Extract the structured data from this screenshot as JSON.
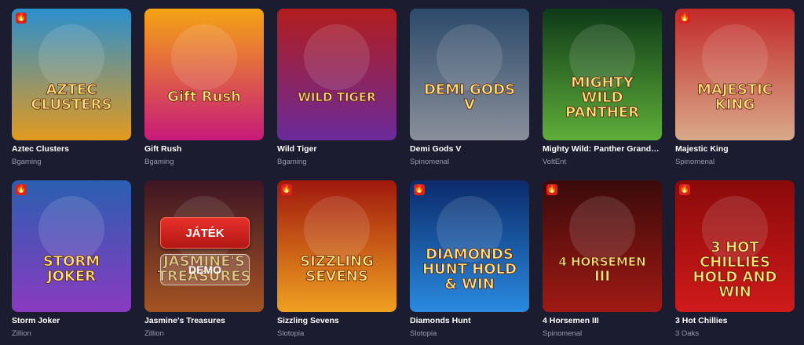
{
  "games": [
    {
      "title": "Aztec Clusters",
      "provider": "Bgaming",
      "hot": true,
      "art_text": "AZTEC CLUSTERS",
      "colors": [
        "#2a8fcf",
        "#e39a1e"
      ]
    },
    {
      "title": "Gift Rush",
      "provider": "Bgaming",
      "hot": false,
      "art_text": "Gift Rush",
      "colors": [
        "#f5a414",
        "#c81a7a"
      ]
    },
    {
      "title": "Wild Tiger",
      "provider": "Bgaming",
      "hot": false,
      "art_text": "WILD TIGER",
      "colors": [
        "#b21d1d",
        "#6a2a9a"
      ]
    },
    {
      "title": "Demi Gods V",
      "provider": "Spinomenal",
      "hot": false,
      "art_text": "DEMI GODS V",
      "colors": [
        "#2c4a6a",
        "#8a8f9a"
      ]
    },
    {
      "title": "Mighty Wild: Panther Grand Diamond Edition",
      "provider": "VoltEnt",
      "hot": false,
      "art_text": "MIGHTY WILD PANTHER",
      "colors": [
        "#0d3a18",
        "#5fae3a"
      ]
    },
    {
      "title": "Majestic King",
      "provider": "Spinomenal",
      "hot": true,
      "art_text": "MAJESTIC KING",
      "colors": [
        "#c22a2a",
        "#d9a98a"
      ]
    },
    {
      "title": "Storm Joker",
      "provider": "Zillion",
      "hot": true,
      "art_text": "STORM JOKER",
      "colors": [
        "#2a5fb0",
        "#8a3ac0"
      ]
    },
    {
      "title": "Jasmine's Treasures",
      "provider": "Zillion",
      "hot": false,
      "art_text": "JASMINE'S TREASURES",
      "colors": [
        "#4a1a2a",
        "#c2632a"
      ]
    },
    {
      "title": "Sizzling Sevens",
      "provider": "Slotopia",
      "hot": true,
      "art_text": "SIZZLING SEVENS",
      "colors": [
        "#a0180e",
        "#f0a020"
      ]
    },
    {
      "title": "Diamonds Hunt",
      "provider": "Slotopia",
      "hot": true,
      "art_text": "DIAMONDS HUNT HOLD & WIN",
      "colors": [
        "#0b2a6a",
        "#2a8ae0"
      ]
    },
    {
      "title": "4 Horsemen III",
      "provider": "Spinomenal",
      "hot": true,
      "art_text": "4 HORSEMEN III",
      "colors": [
        "#3a0a0a",
        "#a01a14"
      ]
    },
    {
      "title": "3 Hot Chillies",
      "provider": "3 Oaks",
      "hot": true,
      "art_text": "3 HOT CHILLIES HOLD AND WIN",
      "colors": [
        "#8a0a0a",
        "#d01a1a"
      ]
    }
  ],
  "hover_card_index": 7,
  "hover_buttons": {
    "play": "JÁTÉK",
    "demo": "DEMO"
  },
  "hot_icon_glyph": "🔥"
}
